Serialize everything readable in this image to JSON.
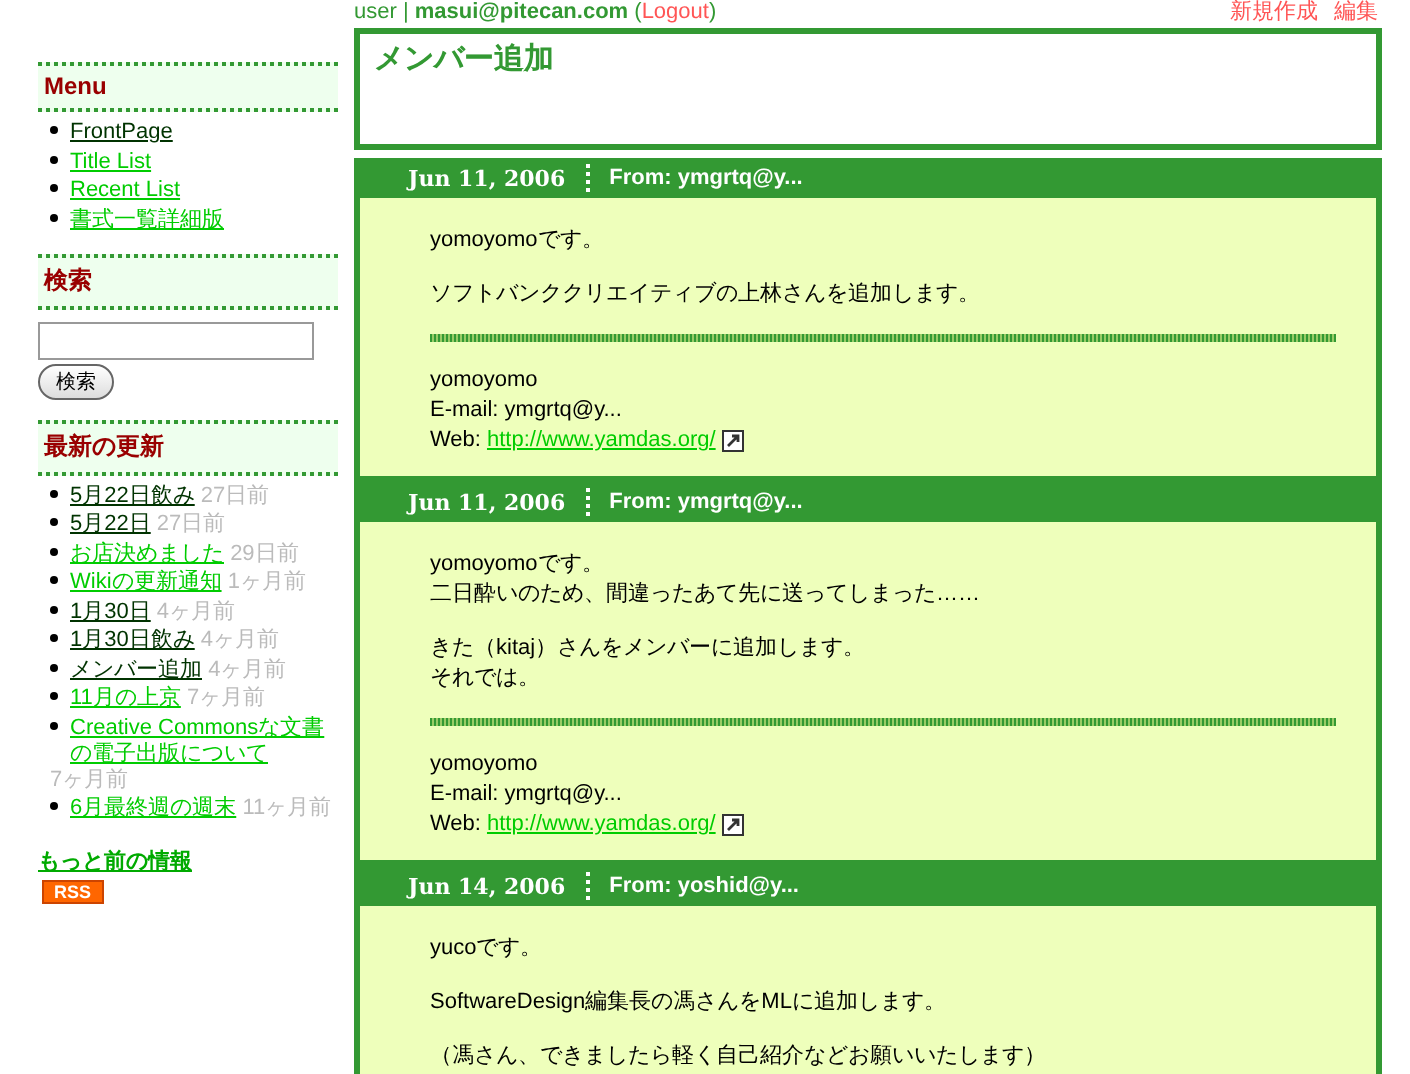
{
  "top_bar": {
    "user_line_before": "user | **masui@pitecan.com** (",
    "logout": "Logout",
    "user_line_after": ")",
    "actions": [
      "新規作成",
      "編集"
    ]
  },
  "page_title": "メンバー追加",
  "menu": {
    "heading": "Menu",
    "items": [
      {
        "label": "FrontPage",
        "visited": true
      },
      {
        "label": "Title List",
        "visited": false
      },
      {
        "label": "Recent List",
        "visited": false
      },
      {
        "label": "書式一覧詳細版",
        "visited": false
      }
    ]
  },
  "search": {
    "heading": "検索",
    "button": "検索"
  },
  "recent": {
    "heading": "最新の更新",
    "items": [
      {
        "label": "5月22日飲み",
        "age": "27日前",
        "visited": true
      },
      {
        "label": "5月22日",
        "age": "27日前",
        "visited": true
      },
      {
        "label": "お店決めました",
        "age": "29日前",
        "visited": false
      },
      {
        "label": "Wikiの更新通知",
        "age": "1ヶ月前",
        "visited": false
      },
      {
        "label": "1月30日",
        "age": "4ヶ月前",
        "visited": true
      },
      {
        "label": "1月30日飲み",
        "age": "4ヶ月前",
        "visited": true
      },
      {
        "label": "メンバー追加",
        "age": "4ヶ月前",
        "visited": true
      },
      {
        "label": "11月の上京",
        "age": "7ヶ月前",
        "visited": false
      },
      {
        "label": "Creative Commonsな文書の電子出版について",
        "age": "7ヶ月前",
        "visited": false
      },
      {
        "label": "6月最終週の週末",
        "age": "11ヶ月前",
        "visited": false
      }
    ],
    "more_link": "もっと前の情報",
    "rss_badge": "RSS"
  },
  "posts": [
    {
      "date": "Jun 11, 2006",
      "from": "From: ymgrtq@y...",
      "paragraphs": [
        [
          "yomoyomoです。"
        ],
        [
          "ソフトバンククリエイティブの上林さんを追加します。"
        ]
      ],
      "signature": {
        "name": "yomoyomo",
        "email": "E-mail: ymgrtq@y...",
        "web_label": "Web:",
        "web_url": "http://www.yamdas.org/"
      }
    },
    {
      "date": "Jun 11, 2006",
      "from": "From: ymgrtq@y...",
      "paragraphs": [
        [
          "yomoyomoです。",
          "二日酔いのため、間違ったあて先に送ってしまった……"
        ],
        [
          "きた（kitaj）さんをメンバーに追加します。",
          "それでは。"
        ]
      ],
      "signature": {
        "name": "yomoyomo",
        "email": "E-mail: ymgrtq@y...",
        "web_label": "Web:",
        "web_url": "http://www.yamdas.org/"
      }
    },
    {
      "date": "Jun 14, 2006",
      "from": "From: yoshid@y...",
      "paragraphs": [
        [
          "yucoです。"
        ],
        [
          "SoftwareDesign編集長の馮さんをMLに追加します。"
        ],
        [
          "（馮さん、できましたら軽く自己紹介などお願いいたします）"
        ]
      ]
    }
  ]
}
